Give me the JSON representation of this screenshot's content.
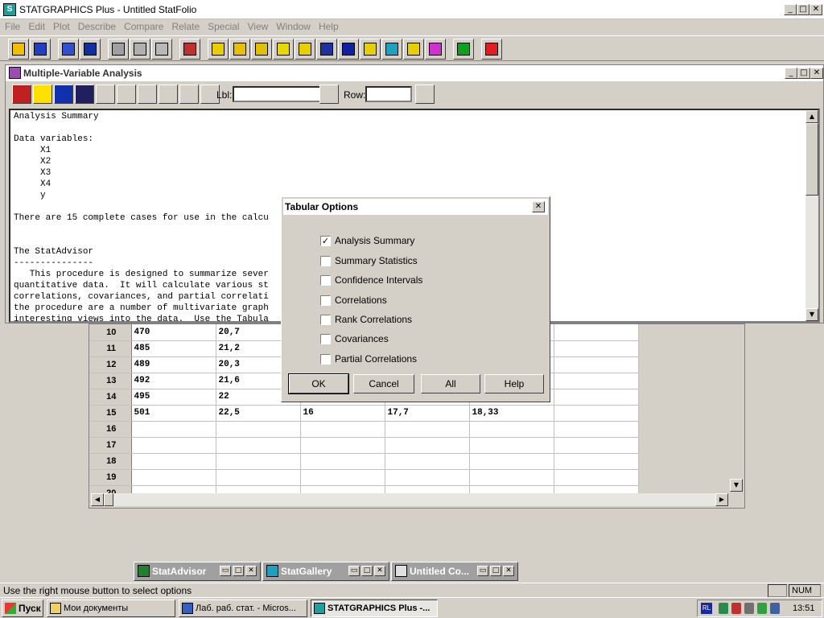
{
  "window": {
    "title": "STATGRAPHICS Plus - Untitled StatFolio",
    "logo": "statgraphics-icon"
  },
  "menu": [
    "File",
    "Edit",
    "Plot",
    "Describe",
    "Compare",
    "Relate",
    "Special",
    "View",
    "Window",
    "Help"
  ],
  "toolbar_icons": [
    "open-folder-icon",
    "save-icon",
    "datasheet-icon",
    "save-data-icon",
    "cut-icon",
    "copy-icon",
    "paste-icon",
    "print-icon",
    "scatterplot-icon",
    "summary-icon",
    "histogram-icon",
    "xy-plot-icon",
    "matrix-icon",
    "line-chart-icon",
    "distribution-icon",
    "trend-icon",
    "globe-icon",
    "tree-icon",
    "matrix-grid-icon",
    "statadvisor-icon",
    "help-icon"
  ],
  "analysis_window": {
    "title": "Multiple-Variable Analysis",
    "lbl_label": "Lbl:",
    "row_label": "Row:",
    "lbl_value": "",
    "row_value": ""
  },
  "output_text": "Analysis Summary\n\nData variables:\n     X1\n     X2\n     X3\n     X4\n     y\n\nThere are 15 complete cases for use in the calcu\n\n\nThe StatAdvisor\n---------------\n   This procedure is designed to summarize sever\nquantitative data.  It will calculate various st\ncorrelations, covariances, and partial correlati\nthe procedure are a number of multivariate graph\ninteresting views into the data.  Use the Tabula",
  "grid_rows": [
    {
      "n": "10",
      "c1": "470",
      "c2": "20,7",
      "c3": "",
      "c4": "",
      "c5": ""
    },
    {
      "n": "11",
      "c1": "485",
      "c2": "21,2",
      "c3": "",
      "c4": "",
      "c5": ""
    },
    {
      "n": "12",
      "c1": "489",
      "c2": "20,3",
      "c3": "",
      "c4": "",
      "c5": ""
    },
    {
      "n": "13",
      "c1": "492",
      "c2": "21,6",
      "c3": "",
      "c4": "",
      "c5": ""
    },
    {
      "n": "14",
      "c1": "495",
      "c2": "22",
      "c3": "",
      "c4": "",
      "c5": ""
    },
    {
      "n": "15",
      "c1": "501",
      "c2": "22,5",
      "c3": "16",
      "c4": "17,7",
      "c5": "18,33"
    },
    {
      "n": "16",
      "c1": "",
      "c2": "",
      "c3": "",
      "c4": "",
      "c5": ""
    },
    {
      "n": "17",
      "c1": "",
      "c2": "",
      "c3": "",
      "c4": "",
      "c5": ""
    },
    {
      "n": "18",
      "c1": "",
      "c2": "",
      "c3": "",
      "c4": "",
      "c5": ""
    },
    {
      "n": "19",
      "c1": "",
      "c2": "",
      "c3": "",
      "c4": "",
      "c5": ""
    },
    {
      "n": "20",
      "c1": "",
      "c2": "",
      "c3": "",
      "c4": "",
      "c5": ""
    }
  ],
  "dialog": {
    "title": "Tabular Options",
    "options": [
      {
        "label": "Analysis Summary",
        "checked": true
      },
      {
        "label": "Summary Statistics",
        "checked": false
      },
      {
        "label": "Confidence Intervals",
        "checked": false
      },
      {
        "label": "Correlations",
        "checked": false
      },
      {
        "label": "Rank Correlations",
        "checked": false
      },
      {
        "label": "Covariances",
        "checked": false
      },
      {
        "label": "Partial Correlations",
        "checked": false
      }
    ],
    "buttons": {
      "ok": "OK",
      "cancel": "Cancel",
      "all": "All",
      "help": "Help"
    }
  },
  "minimized": [
    {
      "title": "StatAdvisor",
      "icon": "statadvisor-icon"
    },
    {
      "title": "StatGallery",
      "icon": "statgallery-icon"
    },
    {
      "title": "Untitled Co...",
      "icon": "comments-icon"
    }
  ],
  "status": {
    "text": "Use the right mouse button to select options",
    "num": "NUM"
  },
  "taskbar": {
    "start": "Пуск",
    "tasks": [
      {
        "label": "Мои документы",
        "active": false
      },
      {
        "label": "Лаб. раб. стат. - Micros...",
        "active": false
      },
      {
        "label": "STATGRAPHICS Plus -...",
        "active": true
      }
    ],
    "lang": "RL",
    "clock": "13:51"
  }
}
